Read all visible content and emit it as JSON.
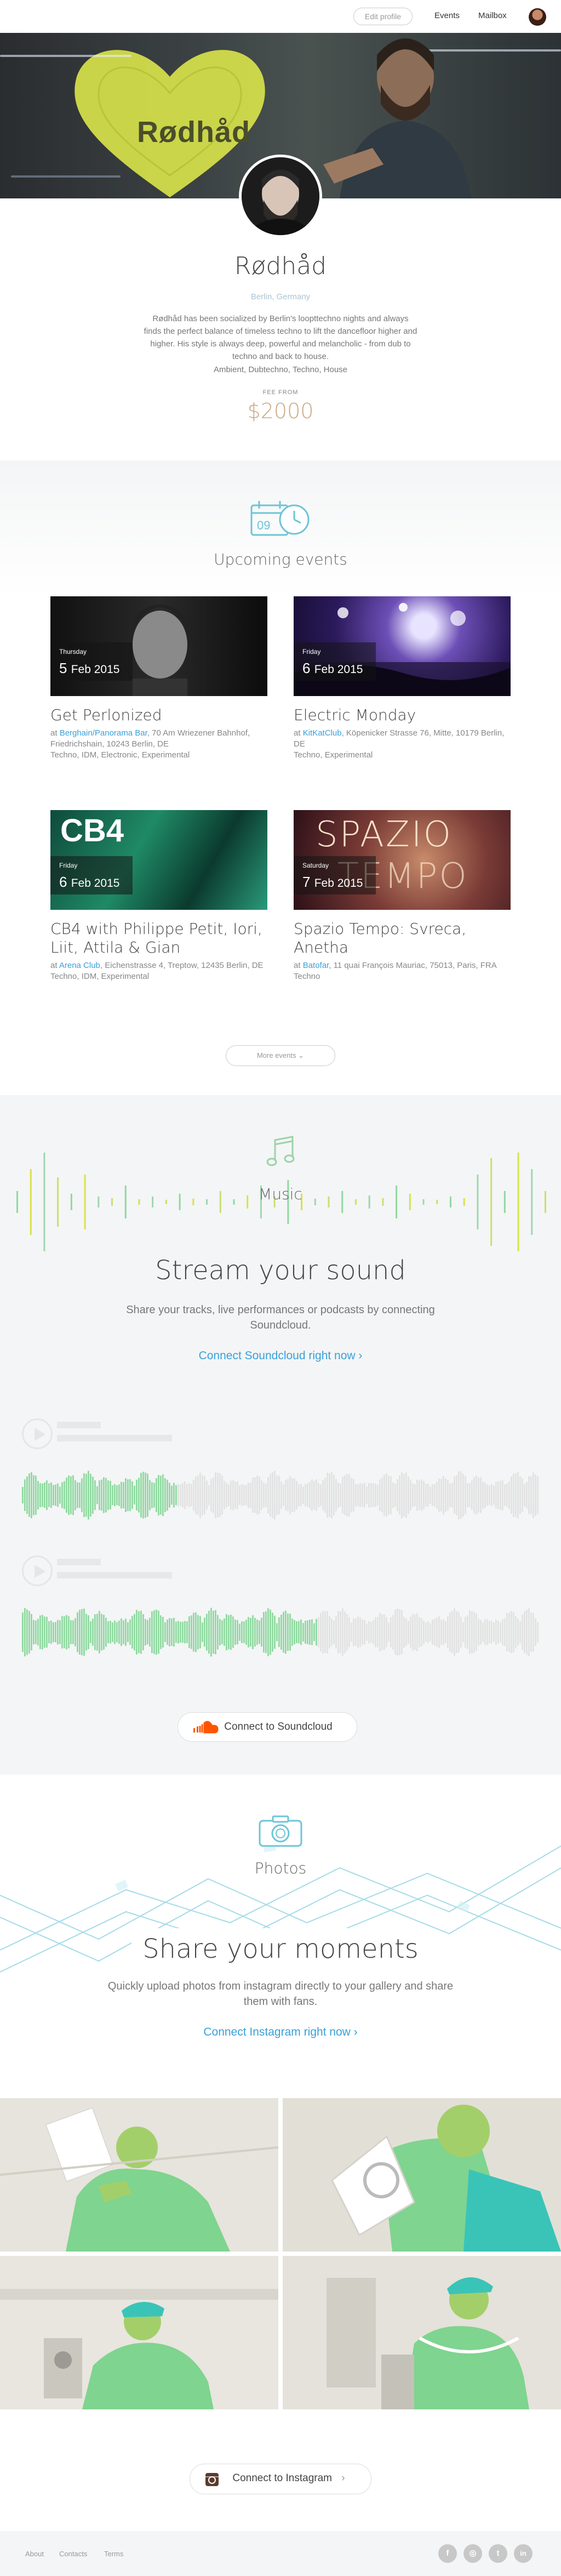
{
  "topbar": {
    "edit_profile": "Edit profile",
    "events": "Events",
    "mailbox": "Mailbox"
  },
  "hero": {
    "wall_text": "Rødhåd"
  },
  "profile": {
    "name": "Rødhåd",
    "location": "Berlin, Germany",
    "bio": "Rødhåd has been socialized by Berlin's loopttechno nights and always finds the perfect balance of timeless techno to lift the dancefloor higher and higher. His style is always deep, powerful and melancholic - from dub to techno and back to house.",
    "genres": "Ambient, Dubtechno, Techno, House",
    "fee_label": "FEE FROM",
    "fee": "$2000"
  },
  "events": {
    "title": "Upcoming events",
    "more_label": "More events",
    "items": [
      {
        "dow": "Thursday",
        "day": "5",
        "month": "Feb 2015",
        "title": "Get Perlonized",
        "venue": "Berghain/Panorama Bar",
        "address": ", 70 Am Wriezener Bahnhof, Friedrichshain, 10243 Berlin, DE",
        "genres": "Techno, IDM, Electronic, Experimental"
      },
      {
        "dow": "Friday",
        "day": "6",
        "month": "Feb 2015",
        "title": "Electric Monday",
        "venue": "KitKatClub",
        "address": ", Köpenicker Strasse 76, Mitte, 10179 Berlin, DE",
        "genres": "Techno, Experimental"
      },
      {
        "dow": "Friday",
        "day": "6",
        "month": "Feb 2015",
        "title": "CB4 with Philippe Petit, Iori, Liit, Attila & Gian",
        "venue": "Arena Club",
        "address": ", Eichenstrasse 4, Treptow, 12435 Berlin, DE",
        "genres": "Techno, IDM, Experimental",
        "img_text": "CB4"
      },
      {
        "dow": "Saturday",
        "day": "7",
        "month": "Feb 2015",
        "title": "Spazio Tempo: Svreca, Anetha",
        "venue": "Batofar",
        "address": ", 11 quai François Mauriac, 75013, Paris, FRA",
        "genres": "Techno",
        "img_text_1": "SPAZIO",
        "img_text_2": "TEMPO"
      }
    ]
  },
  "music": {
    "label": "Music",
    "headline": "Stream your sound",
    "sub": "Share your tracks, live performances or podcasts by connecting Soundcloud.",
    "cta": "Connect Soundcloud right now ›",
    "button": "Connect to Soundcloud",
    "tracks": [
      {
        "progress": 0.3
      },
      {
        "progress": 0.57
      }
    ]
  },
  "photos": {
    "label": "Photos",
    "headline": "Share your moments",
    "sub": "Quickly upload photos from instagram directly to your gallery and share them with fans.",
    "cta": "Connect Instagram right now ›",
    "button": "Connect to Instagram"
  },
  "footer": {
    "about": "About",
    "contacts": "Contacts",
    "terms": "Terms",
    "social": [
      "f",
      "◎",
      "t",
      "in"
    ]
  },
  "colors": {
    "accent_blue": "#3aa0d8",
    "fee_gold": "#c9a885",
    "wave_green": "#8fd9a0",
    "soundcloud_orange": "#ff5500"
  }
}
